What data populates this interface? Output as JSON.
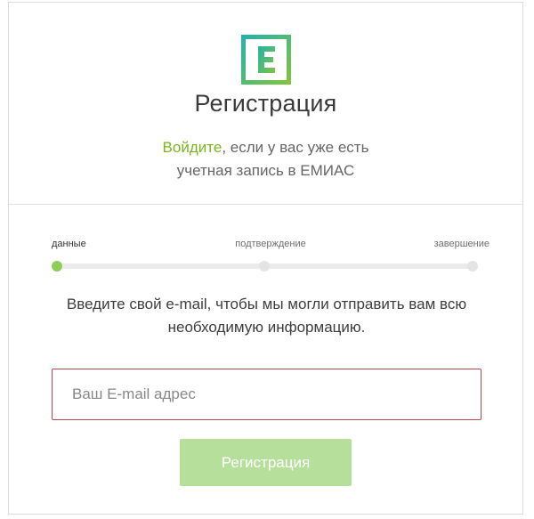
{
  "logo": {
    "letter": "E",
    "icon": "emias-logo-icon",
    "colors": [
      "#2bb3a5",
      "#7bc142"
    ]
  },
  "title": "Регистрация",
  "login_hint": {
    "link_text": "Войдите",
    "line1_rest": ", если у вас уже есть",
    "line2": "учетная запись в ЕМИАС"
  },
  "steps": [
    {
      "label": "данные",
      "state": "active"
    },
    {
      "label": "подтверждение",
      "state": "pending"
    },
    {
      "label": "завершение",
      "state": "pending"
    }
  ],
  "progress": {
    "current_step": 1,
    "total_steps": 3
  },
  "instruction": {
    "line1": "Введите свой e-mail, чтобы мы могли отправить вам всю",
    "line2": "необходимую информацию."
  },
  "email_field": {
    "placeholder": "Ваш E-mail адрес",
    "value": "",
    "state": "error"
  },
  "submit_button": {
    "label": "Регистрация",
    "state": "disabled"
  },
  "colors": {
    "accent_green": "#7ab51d",
    "active_step": "#8ccf57",
    "button_disabled": "#b6df9c",
    "error_border": "#b84848"
  }
}
